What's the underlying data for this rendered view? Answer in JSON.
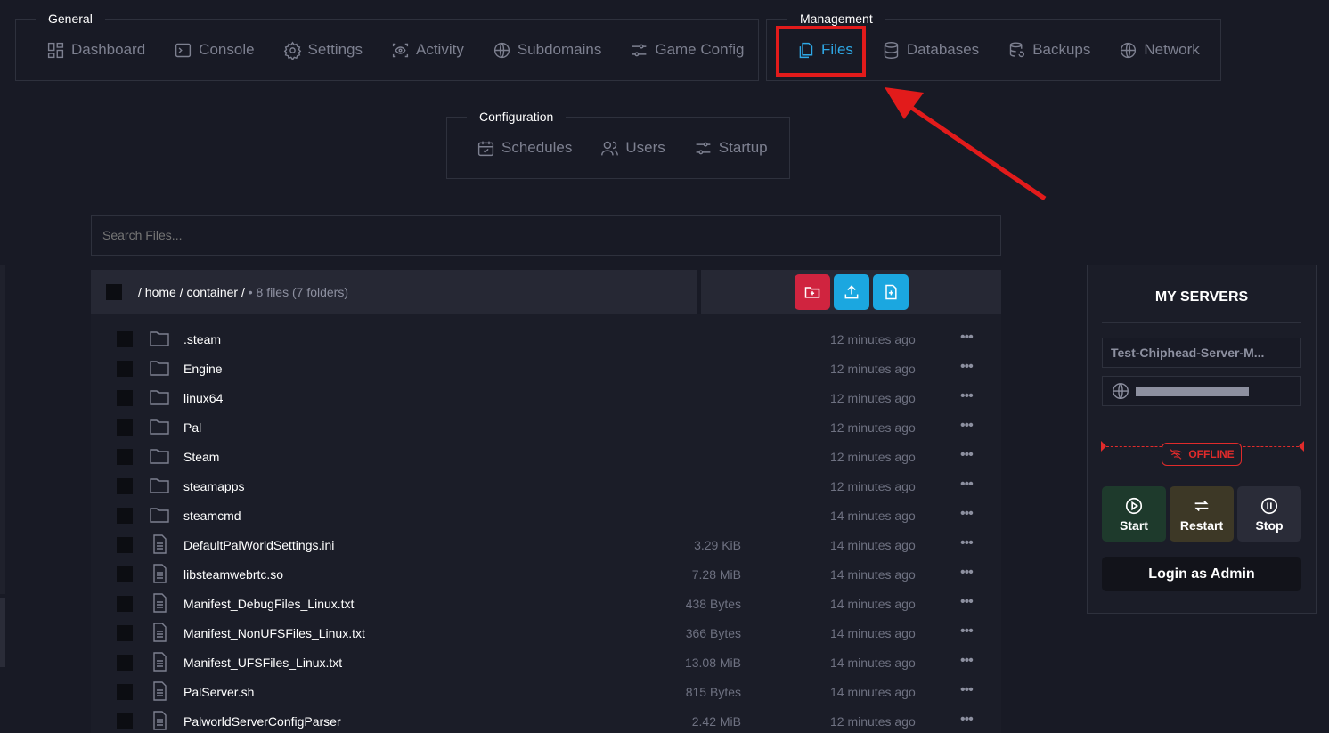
{
  "nav": {
    "general": {
      "legend": "General",
      "items": [
        {
          "label": "Dashboard",
          "icon": "dashboard-icon"
        },
        {
          "label": "Console",
          "icon": "console-icon"
        },
        {
          "label": "Settings",
          "icon": "gear-icon"
        },
        {
          "label": "Activity",
          "icon": "eye-icon"
        },
        {
          "label": "Subdomains",
          "icon": "globe-icon"
        },
        {
          "label": "Game Config",
          "icon": "sliders-icon"
        }
      ]
    },
    "management": {
      "legend": "Management",
      "items": [
        {
          "label": "Files",
          "icon": "files-icon",
          "active": true
        },
        {
          "label": "Databases",
          "icon": "database-icon"
        },
        {
          "label": "Backups",
          "icon": "backup-icon"
        },
        {
          "label": "Network",
          "icon": "globe-icon"
        }
      ]
    },
    "configuration": {
      "legend": "Configuration",
      "items": [
        {
          "label": "Schedules",
          "icon": "calendar-icon"
        },
        {
          "label": "Users",
          "icon": "users-icon"
        },
        {
          "label": "Startup",
          "icon": "sliders-icon"
        }
      ]
    }
  },
  "search": {
    "placeholder": "Search Files..."
  },
  "breadcrumb": {
    "path": "/ home / container /",
    "summary": " • 8 files (7 folders)"
  },
  "actions": [
    {
      "name": "new-folder-button",
      "icon": "folder-plus-icon",
      "color": "#d0243f"
    },
    {
      "name": "upload-button",
      "icon": "upload-icon",
      "color": "#1ba7e0"
    },
    {
      "name": "new-file-button",
      "icon": "file-plus-icon",
      "color": "#1ba7e0"
    }
  ],
  "files": [
    {
      "name": ".steam",
      "type": "folder",
      "size": "",
      "modified": "12 minutes ago"
    },
    {
      "name": "Engine",
      "type": "folder",
      "size": "",
      "modified": "12 minutes ago"
    },
    {
      "name": "linux64",
      "type": "folder",
      "size": "",
      "modified": "12 minutes ago"
    },
    {
      "name": "Pal",
      "type": "folder",
      "size": "",
      "modified": "12 minutes ago"
    },
    {
      "name": "Steam",
      "type": "folder",
      "size": "",
      "modified": "12 minutes ago"
    },
    {
      "name": "steamapps",
      "type": "folder",
      "size": "",
      "modified": "12 minutes ago"
    },
    {
      "name": "steamcmd",
      "type": "folder",
      "size": "",
      "modified": "14 minutes ago"
    },
    {
      "name": "DefaultPalWorldSettings.ini",
      "type": "file",
      "size": "3.29 KiB",
      "modified": "14 minutes ago"
    },
    {
      "name": "libsteamwebrtc.so",
      "type": "file",
      "size": "7.28 MiB",
      "modified": "14 minutes ago"
    },
    {
      "name": "Manifest_DebugFiles_Linux.txt",
      "type": "file",
      "size": "438 Bytes",
      "modified": "14 minutes ago"
    },
    {
      "name": "Manifest_NonUFSFiles_Linux.txt",
      "type": "file",
      "size": "366 Bytes",
      "modified": "14 minutes ago"
    },
    {
      "name": "Manifest_UFSFiles_Linux.txt",
      "type": "file",
      "size": "13.08 MiB",
      "modified": "14 minutes ago"
    },
    {
      "name": "PalServer.sh",
      "type": "file",
      "size": "815 Bytes",
      "modified": "14 minutes ago"
    },
    {
      "name": "PalworldServerConfigParser",
      "type": "file",
      "size": "2.42 MiB",
      "modified": "12 minutes ago"
    }
  ],
  "servers": {
    "title": "MY SERVERS",
    "server_name": "Test-Chiphead-Server-M...",
    "status": "OFFLINE",
    "buttons": [
      {
        "label": "Start",
        "icon": "play-icon",
        "color": "#1e3a2c"
      },
      {
        "label": "Restart",
        "icon": "restart-icon",
        "color": "#3d3826"
      },
      {
        "label": "Stop",
        "icon": "pause-icon",
        "color": "#2a2c38"
      }
    ],
    "admin_label": "Login as Admin"
  },
  "colors": {
    "accent": "#2ea8e6",
    "highlight": "#e21b1b",
    "danger": "#e02b2b"
  }
}
